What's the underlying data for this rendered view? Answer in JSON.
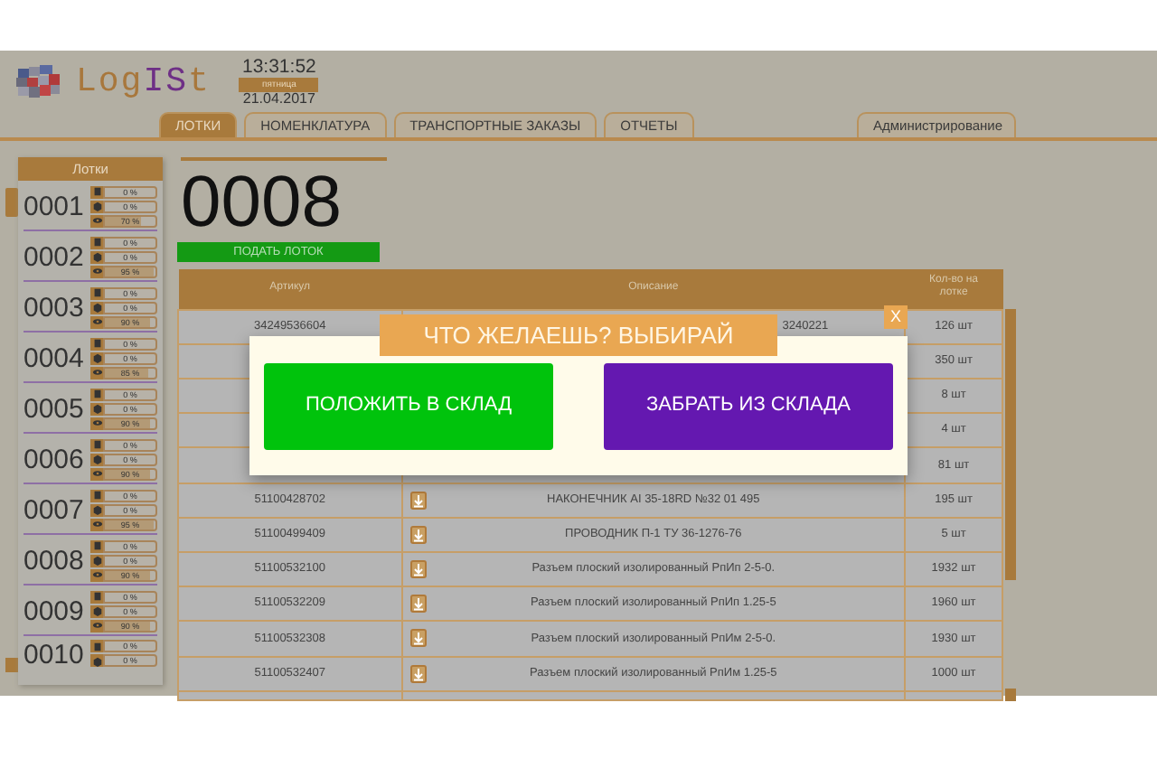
{
  "logo": {
    "parts": [
      {
        "text": "Log",
        "color": "#a8773c"
      },
      {
        "text": "IS",
        "color": "#6e2f86"
      },
      {
        "text": "t",
        "color": "#a8773c"
      }
    ]
  },
  "clock": {
    "time": "13:31:52",
    "weekday": "пятница",
    "date": "21.04.2017"
  },
  "tabs": [
    {
      "label": "ЛОТКИ",
      "selected": true
    },
    {
      "label": "НОМЕНКЛАТУРА",
      "selected": false
    },
    {
      "label": "ТРАНСПОРТНЫЕ ЗАКАЗЫ",
      "selected": false
    },
    {
      "label": "ОТЧЕТЫ",
      "selected": false
    }
  ],
  "admin_tab": {
    "label": "Администрирование",
    "selected": false
  },
  "trays_panel": {
    "title": "Лотки",
    "trays": [
      {
        "number": "0001",
        "bars": [
          {
            "kind": "box",
            "level": 0,
            "reading": "0 %"
          },
          {
            "kind": "cube",
            "level": 0,
            "reading": "0 %"
          },
          {
            "kind": "eye",
            "level": 0.7,
            "reading": "70 %"
          }
        ]
      },
      {
        "number": "0002",
        "bars": [
          {
            "kind": "box",
            "level": 0,
            "reading": "0 %"
          },
          {
            "kind": "cube",
            "level": 0,
            "reading": "0 %"
          },
          {
            "kind": "eye",
            "level": 0.95,
            "reading": "95 %"
          }
        ]
      },
      {
        "number": "0003",
        "bars": [
          {
            "kind": "box",
            "level": 0,
            "reading": "0 %"
          },
          {
            "kind": "cube",
            "level": 0,
            "reading": "0 %"
          },
          {
            "kind": "eye",
            "level": 0.9,
            "reading": "90 %"
          }
        ]
      },
      {
        "number": "0004",
        "bars": [
          {
            "kind": "box",
            "level": 0,
            "reading": "0 %"
          },
          {
            "kind": "cube",
            "level": 0,
            "reading": "0 %"
          },
          {
            "kind": "eye",
            "level": 0.85,
            "reading": "85 %"
          }
        ]
      },
      {
        "number": "0005",
        "bars": [
          {
            "kind": "box",
            "level": 0,
            "reading": "0 %"
          },
          {
            "kind": "cube",
            "level": 0,
            "reading": "0 %"
          },
          {
            "kind": "eye",
            "level": 0.9,
            "reading": "90 %"
          }
        ]
      },
      {
        "number": "0006",
        "bars": [
          {
            "kind": "box",
            "level": 0,
            "reading": "0 %"
          },
          {
            "kind": "cube",
            "level": 0,
            "reading": "0 %"
          },
          {
            "kind": "eye",
            "level": 0.9,
            "reading": "90 %"
          }
        ]
      },
      {
        "number": "0007",
        "bars": [
          {
            "kind": "box",
            "level": 0,
            "reading": "0 %"
          },
          {
            "kind": "cube",
            "level": 0,
            "reading": "0 %"
          },
          {
            "kind": "eye",
            "level": 0.95,
            "reading": "95 %"
          }
        ]
      },
      {
        "number": "0008",
        "bars": [
          {
            "kind": "box",
            "level": 0,
            "reading": "0 %"
          },
          {
            "kind": "cube",
            "level": 0,
            "reading": "0 %"
          },
          {
            "kind": "eye",
            "level": 0.9,
            "reading": "90 %"
          }
        ]
      },
      {
        "number": "0009",
        "bars": [
          {
            "kind": "box",
            "level": 0,
            "reading": "0 %"
          },
          {
            "kind": "cube",
            "level": 0,
            "reading": "0 %"
          },
          {
            "kind": "eye",
            "level": 0.9,
            "reading": "90 %"
          }
        ]
      },
      {
        "number": "0010",
        "bars": [
          {
            "kind": "box",
            "level": 0,
            "reading": "0 %"
          },
          {
            "kind": "cube",
            "level": 0,
            "reading": "0 %"
          }
        ]
      }
    ]
  },
  "current_tray": {
    "number": "0008",
    "button": "ПОДАТЬ ЛОТОК"
  },
  "table": {
    "columns": [
      "Артикул",
      "Описание",
      "Кол-во на лотке"
    ],
    "rows": [
      {
        "article": "34249536604",
        "description": "3240221",
        "partial": true,
        "icon": false,
        "quantity": "126 шт"
      },
      {
        "icon": false,
        "quantity": "350 шт"
      },
      {
        "icon": false,
        "quantity": "8 шт"
      },
      {
        "icon": false,
        "quantity": "4 шт"
      },
      {
        "icon": false,
        "quantity": "81 шт"
      },
      {
        "article": "51100428702",
        "description": "НАКОНЕЧНИК AI 35-18RD №32 01 495",
        "icon": true,
        "quantity": "195 шт"
      },
      {
        "article": "51100499409",
        "description": "ПРОВОДНИК П-1 ТУ 36-1276-76",
        "icon": true,
        "quantity": "5 шт"
      },
      {
        "article": "51100532100",
        "description": "Разъем плоский изолированный РпИп 2-5-0.",
        "icon": true,
        "quantity": "1932 шт"
      },
      {
        "article": "51100532209",
        "description": "Разъем плоский изолированный РпИп 1.25-5",
        "icon": true,
        "quantity": "1960 шт"
      },
      {
        "article": "51100532308",
        "description": "Разъем плоский изолированный РпИм 2-5-0.",
        "icon": true,
        "quantity": "1930 шт"
      },
      {
        "article": "51100532407",
        "description": "Разъем плоский изолированный РпИм 1.25-5",
        "icon": true,
        "quantity": "1000 шт"
      }
    ]
  },
  "dialog": {
    "title": "ЧТО ЖЕЛАЕШЬ? ВЫБИРАЙ",
    "close": "X",
    "buttons": [
      {
        "label": "ПОЛОЖИТЬ В СКЛАД",
        "kind": "put"
      },
      {
        "label": "ЗАБРАТЬ ИЗ СКЛАДА",
        "kind": "take"
      }
    ]
  }
}
